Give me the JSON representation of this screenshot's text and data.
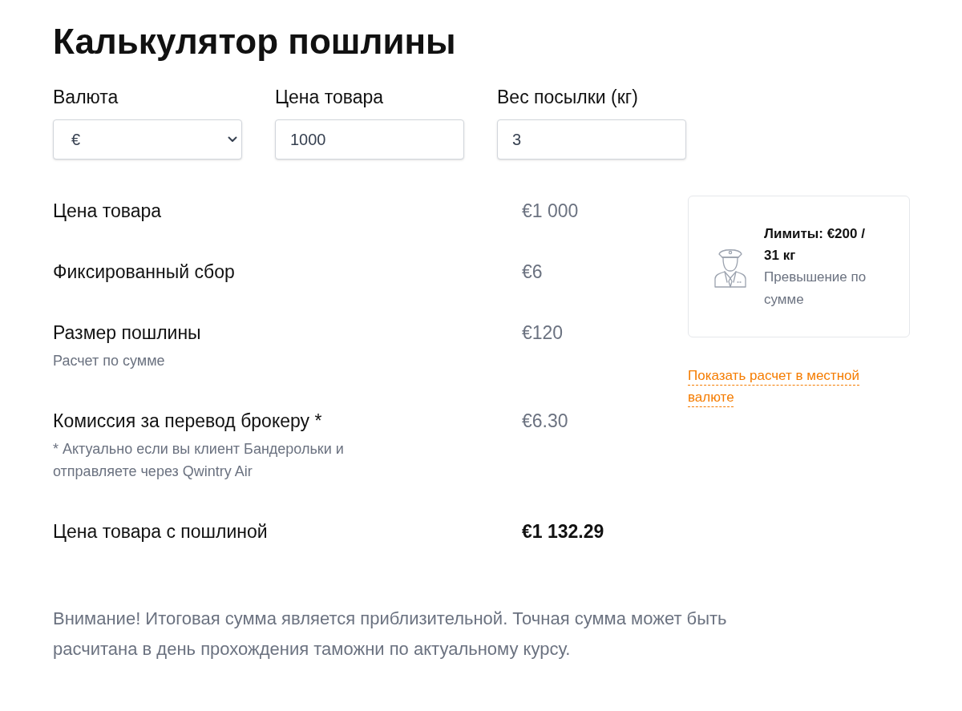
{
  "title": "Калькулятор пошлины",
  "fields": [
    {
      "kind": "select",
      "label": "Валюта",
      "value": "€"
    },
    {
      "kind": "input",
      "label": "Цена товара",
      "value": "1000"
    },
    {
      "kind": "input",
      "label": "Вес посылки (кг)",
      "value": "3"
    }
  ],
  "rows": [
    {
      "kind": "item",
      "label": "Цена товара",
      "value": "€1 000"
    },
    {
      "kind": "item",
      "label": "Фиксированный сбор",
      "value": "€6"
    },
    {
      "kind": "item",
      "label": "Размер пошлины",
      "note": "Расчет по сумме",
      "value": "€120"
    },
    {
      "kind": "item",
      "label": "Комиссия за перевод брокеру *",
      "note": "* Актуально если вы клиент Бандерольки и отправляете через Qwintry Air",
      "value": "€6.30"
    },
    {
      "kind": "total",
      "label": "Цена товара с пошлиной",
      "value": "€1 132.29"
    }
  ],
  "limits_card": {
    "title": "Лимиты: €200 / 31 кг",
    "status": "Превышение по сумме"
  },
  "local_currency_link": "Показать расчет в местной валюте",
  "warning": "Внимание! Итоговая сумма является приблизительной. Точная сумма может быть расчитана в день прохождения таможни по актуальному курсу."
}
